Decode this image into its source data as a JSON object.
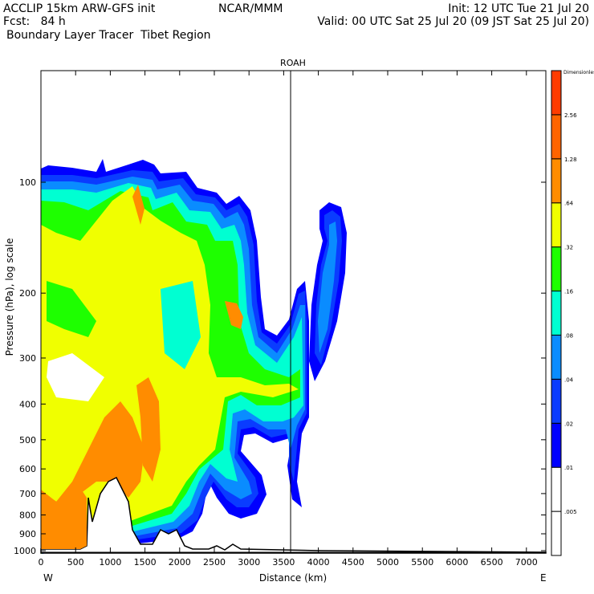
{
  "header": {
    "model": "ACCLIP 15km ARW-GFS init",
    "org": "NCAR/MMM",
    "init": "Init: 12 UTC Tue 21 Jul 20",
    "fcst": "Fcst:   84 h",
    "valid": "Valid: 00 UTC Sat 25 Jul 20 (09 JST Sat 25 Jul 20)",
    "field": "Boundary Layer Tracer  Tibet Region"
  },
  "chart_data": {
    "type": "heatmap",
    "subtype": "filled-contour cross-section",
    "title": "ROAH",
    "xlabel": "Distance (km)",
    "ylabel": "Pressure (hPa), log scale",
    "x_left_label": "W",
    "x_right_label": "E",
    "xlim": [
      0,
      7280
    ],
    "ylim": [
      1000,
      50
    ],
    "xticks": [
      0,
      500,
      1000,
      1500,
      2000,
      2500,
      3000,
      3500,
      4000,
      4500,
      5000,
      5500,
      6000,
      6500,
      7000
    ],
    "yticks": [
      100,
      200,
      300,
      400,
      500,
      600,
      700,
      800,
      900,
      1000
    ],
    "marker_line_km": 3600,
    "colorbar": {
      "units_label": "Dimensionless",
      "levels": [
        ".005",
        ".01",
        ".02",
        ".04",
        ".08",
        ".16",
        ".32",
        ".64",
        "1.28",
        "2.56"
      ],
      "colors": [
        "#ffffff",
        "#ffffff",
        "#0000ff",
        "#0a3cff",
        "#0a8cff",
        "#00ffd2",
        "#1eff00",
        "#f0ff00",
        "#ff8c00",
        "#ff6400",
        "#ff3c00"
      ]
    }
  }
}
